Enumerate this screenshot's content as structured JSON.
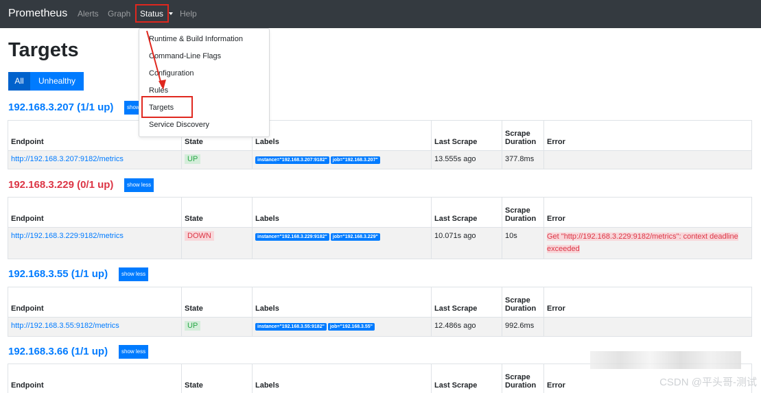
{
  "nav": {
    "brand": "Prometheus",
    "alerts": "Alerts",
    "graph": "Graph",
    "status": "Status",
    "help": "Help"
  },
  "page_title": "Targets",
  "filter": {
    "all": "All",
    "unhealthy": "Unhealthy"
  },
  "columns": {
    "endpoint": "Endpoint",
    "state": "State",
    "labels": "Labels",
    "last_scrape": "Last Scrape",
    "scrape_duration_1": "Scrape",
    "scrape_duration_2": "Duration",
    "error": "Error"
  },
  "groups": [
    {
      "title": "192.168.3.207 (1/1 up)",
      "toggle": "show less",
      "endpoint": "http://192.168.3.207:9182/metrics",
      "state": "UP",
      "label_instance": "instance=\"192.168.3.207:9182\"",
      "label_job": "job=\"192.168.3.207\"",
      "last_scrape": "13.555s ago",
      "duration": "377.8ms",
      "error": ""
    },
    {
      "title": "192.168.3.229 (0/1 up)",
      "toggle": "show less",
      "endpoint": "http://192.168.3.229:9182/metrics",
      "state": "DOWN",
      "label_instance": "instance=\"192.168.3.229:9182\"",
      "label_job": "job=\"192.168.3.229\"",
      "last_scrape": "10.071s ago",
      "duration": "10s",
      "error": "Get \"http://192.168.3.229:9182/metrics\": context deadline exceeded"
    },
    {
      "title": "192.168.3.55 (1/1 up)",
      "toggle": "show less",
      "endpoint": "http://192.168.3.55:9182/metrics",
      "state": "UP",
      "label_instance": "instance=\"192.168.3.55:9182\"",
      "label_job": "job=\"192.168.3.55\"",
      "last_scrape": "12.486s ago",
      "duration": "992.6ms",
      "error": ""
    },
    {
      "title": "192.168.3.66 (1/1 up)",
      "toggle": "show less"
    }
  ],
  "status_menu": {
    "items": [
      "Runtime & Build Information",
      "Command-Line Flags",
      "Configuration",
      "Rules",
      "Targets",
      "Service Discovery"
    ]
  },
  "watermark": "CSDN @平头哥-测试",
  "colors": {
    "navbar": "#343a40",
    "primary": "#007bff",
    "danger": "#dc3545",
    "success": "#28a745",
    "annotation": "#e0271e"
  }
}
